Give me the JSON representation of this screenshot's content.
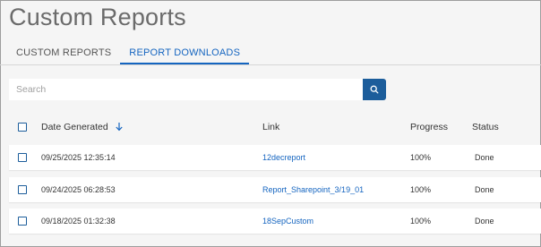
{
  "page": {
    "title": "Custom Reports"
  },
  "tabs": [
    {
      "label": "CUSTOM REPORTS",
      "active": false
    },
    {
      "label": "REPORT DOWNLOADS",
      "active": true
    }
  ],
  "search": {
    "placeholder": "Search",
    "value": "",
    "icon": "search-icon"
  },
  "table": {
    "columns": {
      "date": "Date Generated",
      "link": "Link",
      "progress": "Progress",
      "status": "Status"
    },
    "sort_icon": "arrow-down-icon",
    "rows": [
      {
        "date": "09/25/2025 12:35:14",
        "link": "12decreport",
        "progress": "100%",
        "status": "Done"
      },
      {
        "date": "09/24/2025 06:28:53",
        "link": "Report_Sharepoint_3/19_01",
        "progress": "100%",
        "status": "Done"
      },
      {
        "date": "09/18/2025 01:32:38",
        "link": "18SepCustom",
        "progress": "100%",
        "status": "Done"
      }
    ]
  },
  "colors": {
    "accent": "#1565c0",
    "button": "#1c5d9b",
    "background": "#f5f5f5"
  }
}
